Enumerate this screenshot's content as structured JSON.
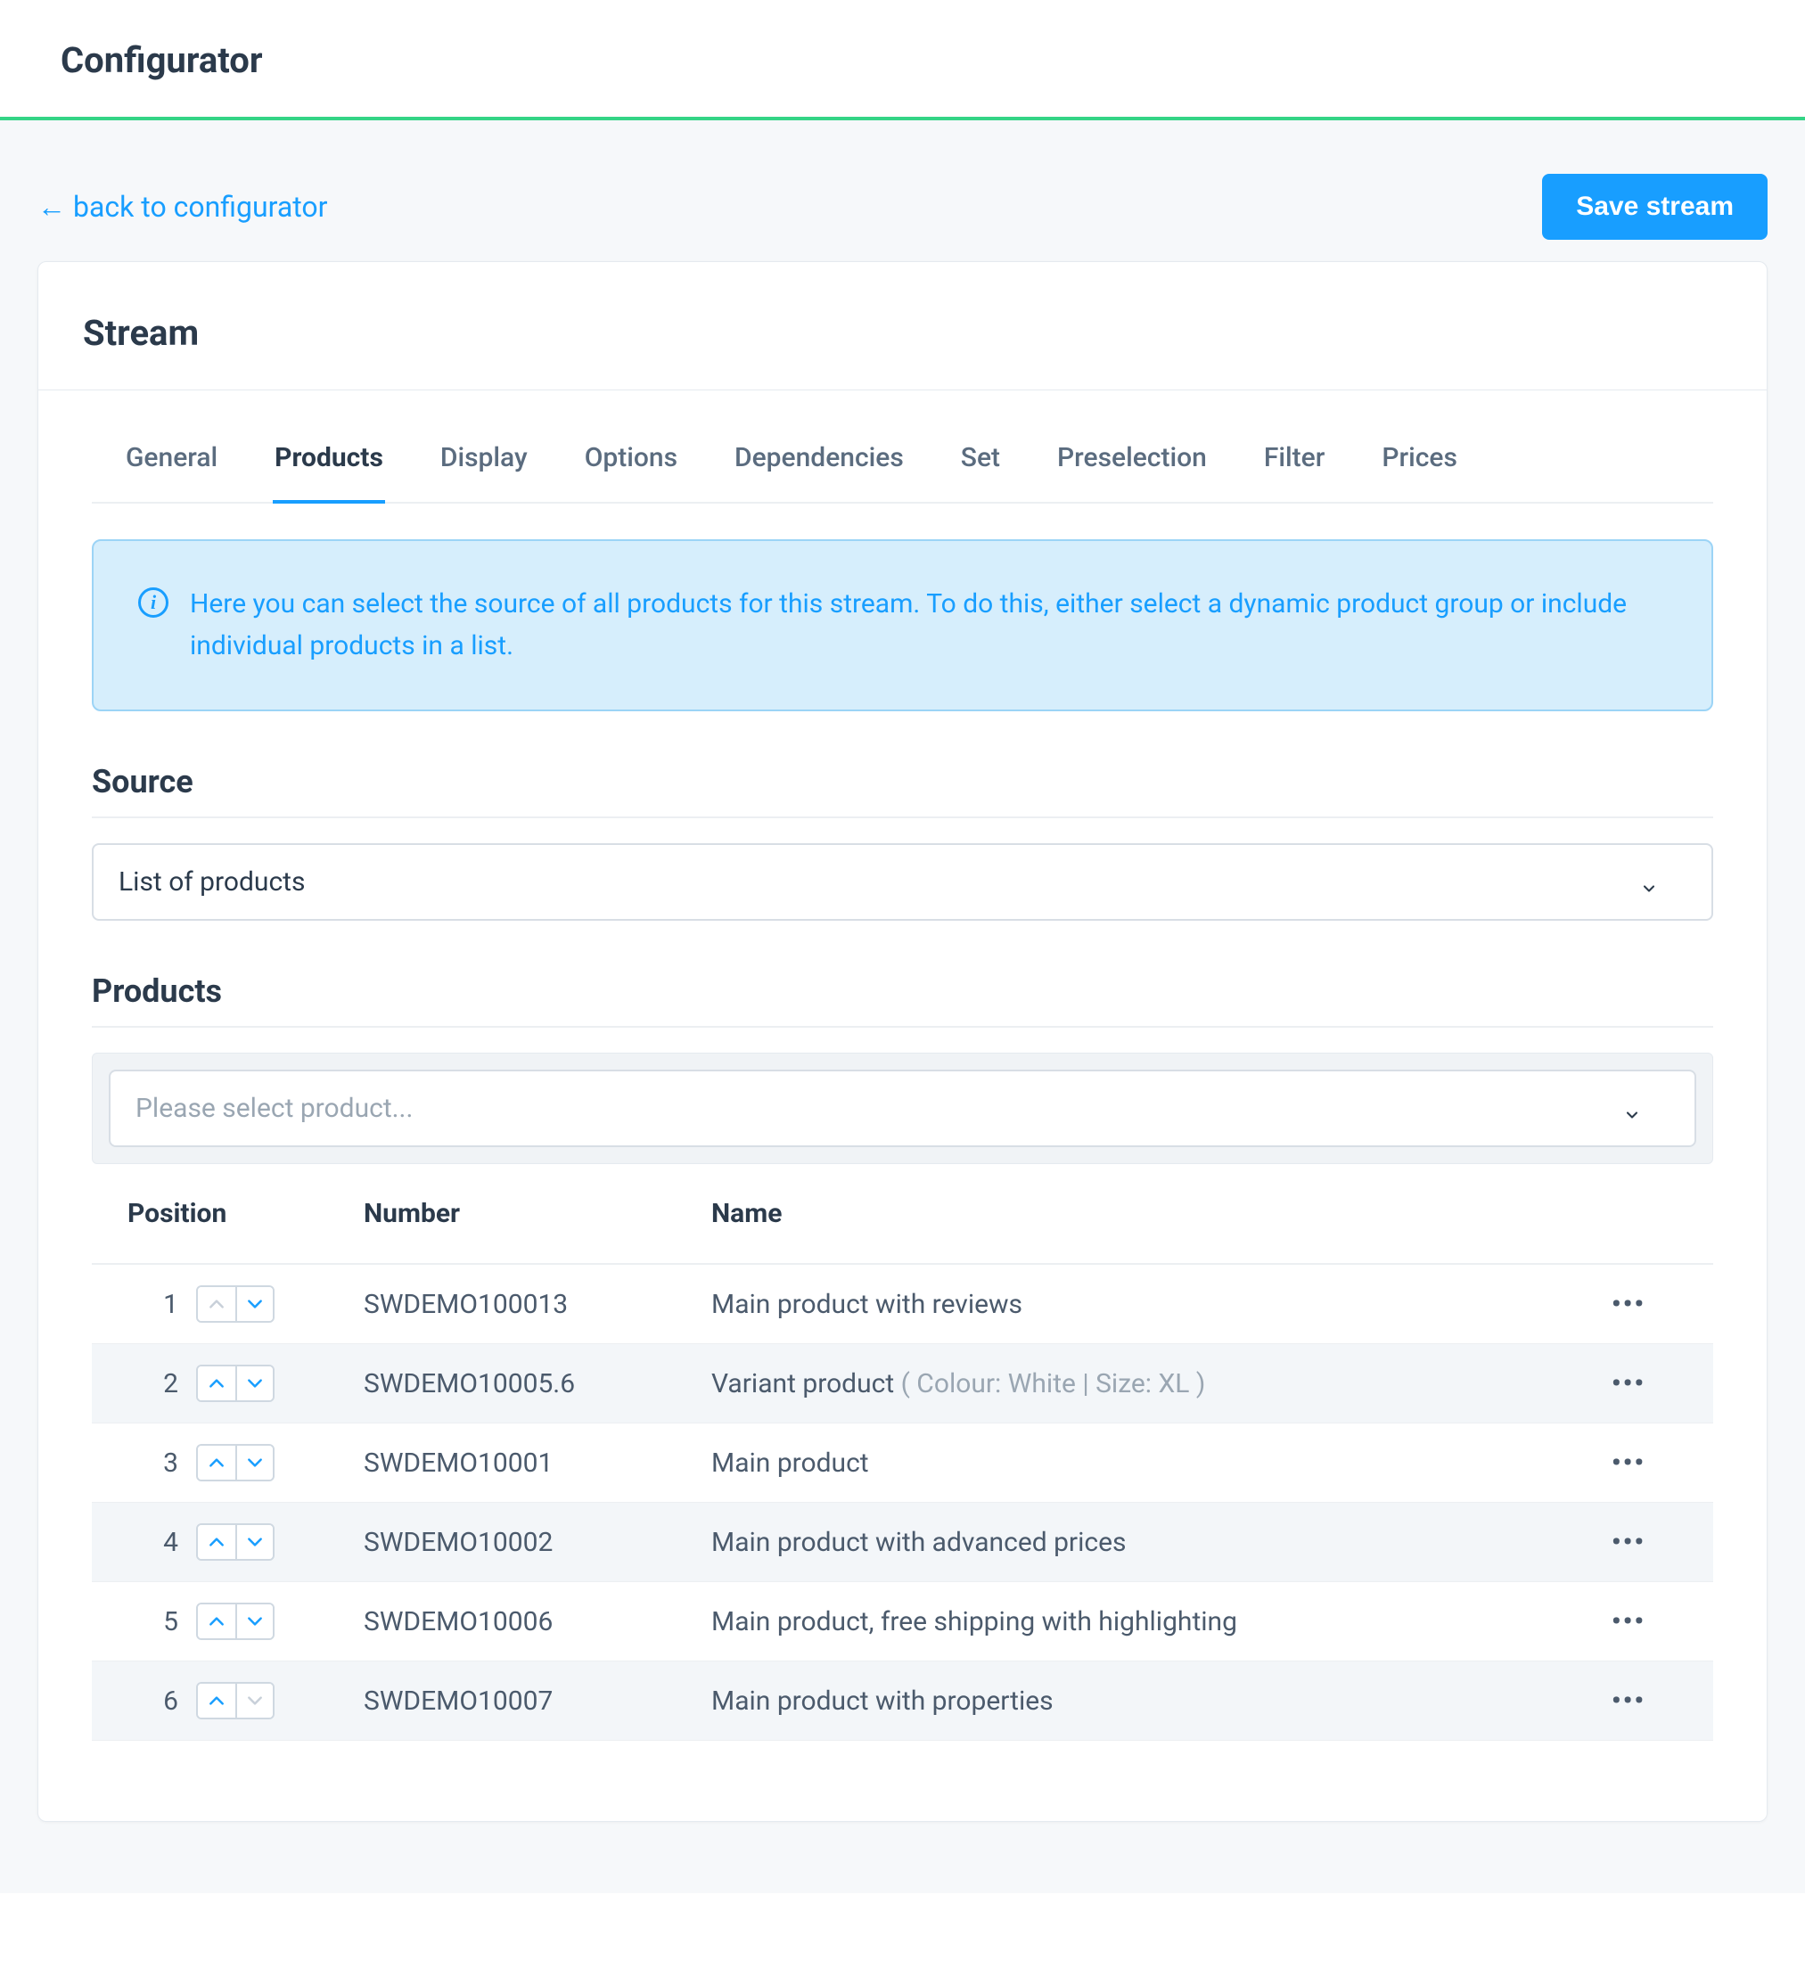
{
  "header": {
    "title": "Configurator"
  },
  "toolbar": {
    "back_label": "back to configurator",
    "save_label": "Save stream"
  },
  "card": {
    "title": "Stream"
  },
  "tabs": [
    {
      "label": "General",
      "active": false
    },
    {
      "label": "Products",
      "active": true
    },
    {
      "label": "Display",
      "active": false
    },
    {
      "label": "Options",
      "active": false
    },
    {
      "label": "Dependencies",
      "active": false
    },
    {
      "label": "Set",
      "active": false
    },
    {
      "label": "Preselection",
      "active": false
    },
    {
      "label": "Filter",
      "active": false
    },
    {
      "label": "Prices",
      "active": false
    }
  ],
  "info": {
    "text": "Here you can select the source of all products for this stream. To do this, either select a dynamic product group or include individual products in a list."
  },
  "source": {
    "heading": "Source",
    "selected": "List of products"
  },
  "products": {
    "heading": "Products",
    "picker_placeholder": "Please select product...",
    "columns": {
      "position": "Position",
      "number": "Number",
      "name": "Name"
    },
    "rows": [
      {
        "pos": "1",
        "number": "SWDEMO100013",
        "name": "Main product with reviews",
        "variant": "",
        "up_disabled": true,
        "down_disabled": false
      },
      {
        "pos": "2",
        "number": "SWDEMO10005.6",
        "name": "Variant product",
        "variant": " ( Colour: White | Size: XL )",
        "up_disabled": false,
        "down_disabled": false
      },
      {
        "pos": "3",
        "number": "SWDEMO10001",
        "name": "Main product",
        "variant": "",
        "up_disabled": false,
        "down_disabled": false
      },
      {
        "pos": "4",
        "number": "SWDEMO10002",
        "name": "Main product with advanced prices",
        "variant": "",
        "up_disabled": false,
        "down_disabled": false
      },
      {
        "pos": "5",
        "number": "SWDEMO10006",
        "name": "Main product, free shipping with highlighting",
        "variant": "",
        "up_disabled": false,
        "down_disabled": false
      },
      {
        "pos": "6",
        "number": "SWDEMO10007",
        "name": "Main product with properties",
        "variant": "",
        "up_disabled": false,
        "down_disabled": true
      }
    ]
  }
}
